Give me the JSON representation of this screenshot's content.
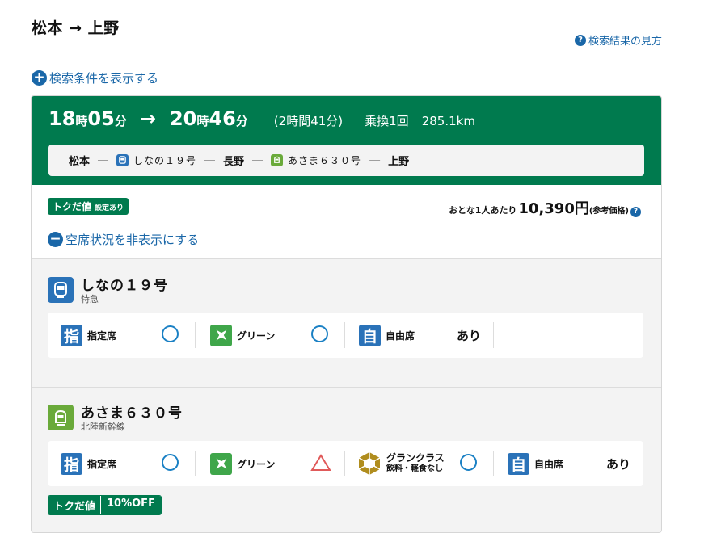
{
  "header": {
    "route": "松本 → 上野",
    "help_link": "検索結果の見方",
    "help_icon": "question-icon",
    "show_conditions": "検索条件を表示する"
  },
  "result": {
    "dep_hour": "18",
    "dep_min": "05",
    "arr_hour": "20",
    "arr_min": "46",
    "hour_unit": "時",
    "min_unit": "分",
    "arrow": "→",
    "duration": "(2時間41分)",
    "transfers": "乗換1回",
    "distance": "285.1km",
    "route": {
      "from": "松本",
      "train1": "しなの１９号",
      "via": "長野",
      "train2": "あさま６３０号",
      "to": "上野",
      "dash": "―"
    },
    "toku_badge": "トクだ値",
    "toku_badge_sub": "設定あり",
    "fare_prefix": "おとな1人あたり",
    "fare_amount": "10,390円",
    "fare_ref": "(参考価格)",
    "hide_seats": "空席状況を非表示にする"
  },
  "trains": [
    {
      "name": "しなの１９号",
      "type": "特急",
      "icon": "limited-express-train-icon",
      "seats": {
        "reserved_label": "指定席",
        "reserved_icon_char": "指",
        "reserved_status": "○",
        "green_label": "グリーン",
        "green_status": "○",
        "free_label": "自由席",
        "free_icon_char": "自",
        "free_status": "あり"
      }
    },
    {
      "name": "あさま６３０号",
      "type": "北陸新幹線",
      "icon": "shinkansen-train-icon",
      "seats": {
        "reserved_label": "指定席",
        "reserved_icon_char": "指",
        "reserved_status": "○",
        "green_label": "グリーン",
        "green_status": "△",
        "gran_label": "グランクラス",
        "gran_sub": "飲料・軽食なし",
        "gran_status": "○",
        "free_label": "自由席",
        "free_icon_char": "自",
        "free_status": "あり"
      },
      "toku_label": "トクだ値",
      "toku_discount": "10%OFF"
    }
  ],
  "colors": {
    "brand_green": "#007a4e",
    "link_blue": "#1a67a8",
    "ring_blue": "#1a80c4",
    "triangle_red": "#e05a5a",
    "gran_gold": "#b08d1e"
  }
}
